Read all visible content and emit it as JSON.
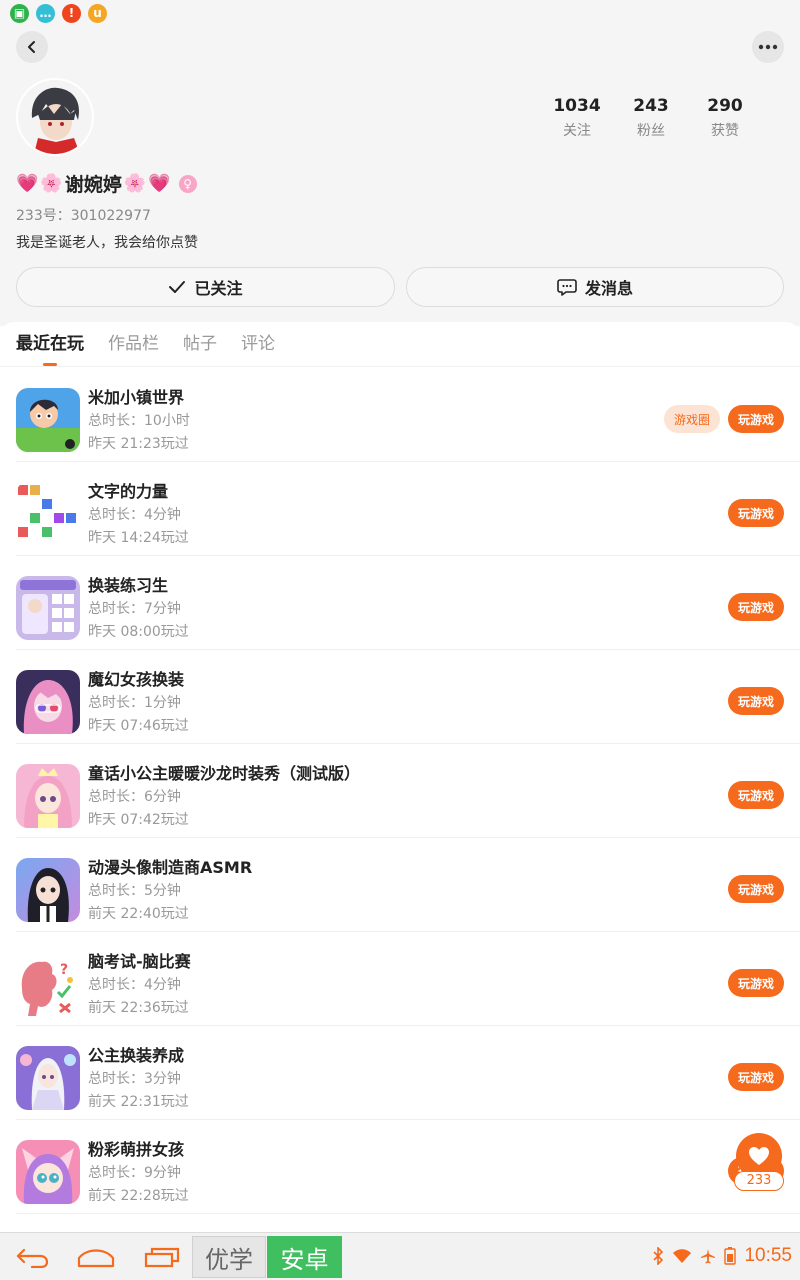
{
  "status_bar": {
    "icons": [
      {
        "name": "gallery-notification-icon",
        "color": "#2db34a",
        "glyph": "▣"
      },
      {
        "name": "message-notification-icon",
        "color": "#33c0d6",
        "glyph": "…"
      },
      {
        "name": "alert-notification-icon",
        "color": "#f0441c",
        "glyph": "!"
      },
      {
        "name": "u-app-notification-icon",
        "color": "#f5a623",
        "glyph": "u"
      }
    ]
  },
  "profile": {
    "nickname": "谢婉婷",
    "uid": "233号：301022977",
    "bio": "我是圣诞老人，我会给你点赞",
    "stats": [
      {
        "value": "1034",
        "label": "关注"
      },
      {
        "value": "243",
        "label": "粉丝"
      },
      {
        "value": "290",
        "label": "获赞"
      }
    ],
    "follow_label": "已关注",
    "message_label": "发消息"
  },
  "tabs": [
    "最近在玩",
    "作品栏",
    "帖子",
    "评论"
  ],
  "games": [
    {
      "title": "米加小镇世界",
      "duration": "总时长：10小时",
      "last_played": "昨天 21:23玩过",
      "circle_label": "游戏圈",
      "play_label": "玩游戏",
      "icon": "toca-world-icon",
      "icon_bg": "#4fa3e8"
    },
    {
      "title": "文字的力量",
      "duration": "总时长：4分钟",
      "last_played": "昨天 14:24玩过",
      "play_label": "玩游戏",
      "icon": "word-power-icon",
      "icon_bg": "#ffffff"
    },
    {
      "title": "换装练习生",
      "duration": "总时长：7分钟",
      "last_played": "昨天 08:00玩过",
      "play_label": "玩游戏",
      "icon": "dressup-trainee-icon",
      "icon_bg": "#c9b8ea"
    },
    {
      "title": "魔幻女孩换装",
      "duration": "总时长：1分钟",
      "last_played": "昨天 07:46玩过",
      "play_label": "玩游戏",
      "icon": "magic-girl-icon",
      "icon_bg": "#3a2e5c"
    },
    {
      "title": "童话小公主暖暖沙龙时装秀（测试版）",
      "duration": "总时长：6分钟",
      "last_played": "昨天 07:42玩过",
      "play_label": "玩游戏",
      "icon": "fairy-princess-icon",
      "icon_bg": "#f6b7d4"
    },
    {
      "title": "动漫头像制造商ASMR",
      "duration": "总时长：5分钟",
      "last_played": "前天 22:40玩过",
      "play_label": "玩游戏",
      "icon": "anime-avatar-icon",
      "icon_bg": "#a98be0"
    },
    {
      "title": "脑考试-脑比赛",
      "duration": "总时长：4分钟",
      "last_played": "前天 22:36玩过",
      "play_label": "玩游戏",
      "icon": "brain-test-icon",
      "icon_bg": "#ffffff"
    },
    {
      "title": "公主换装养成",
      "duration": "总时长：3分钟",
      "last_played": "前天 22:31玩过",
      "play_label": "玩游戏",
      "icon": "princess-dressup-icon",
      "icon_bg": "#8a6fd6"
    },
    {
      "title": "粉彩萌拼女孩",
      "duration": "总时长：9分钟",
      "last_played": "前天 22:28玩过",
      "play_label": "玩游戏",
      "icon": "pastel-girl-icon",
      "icon_bg": "#f58fb6"
    }
  ],
  "float_like": {
    "count": "233"
  },
  "nav_bar": {
    "text_a": "优学",
    "text_b": "安卓",
    "clock": "10:55"
  },
  "colors": {
    "accent": "#f56a1c",
    "header_bg": "#f5f5f5",
    "nav_green": "#3fbf5f"
  }
}
